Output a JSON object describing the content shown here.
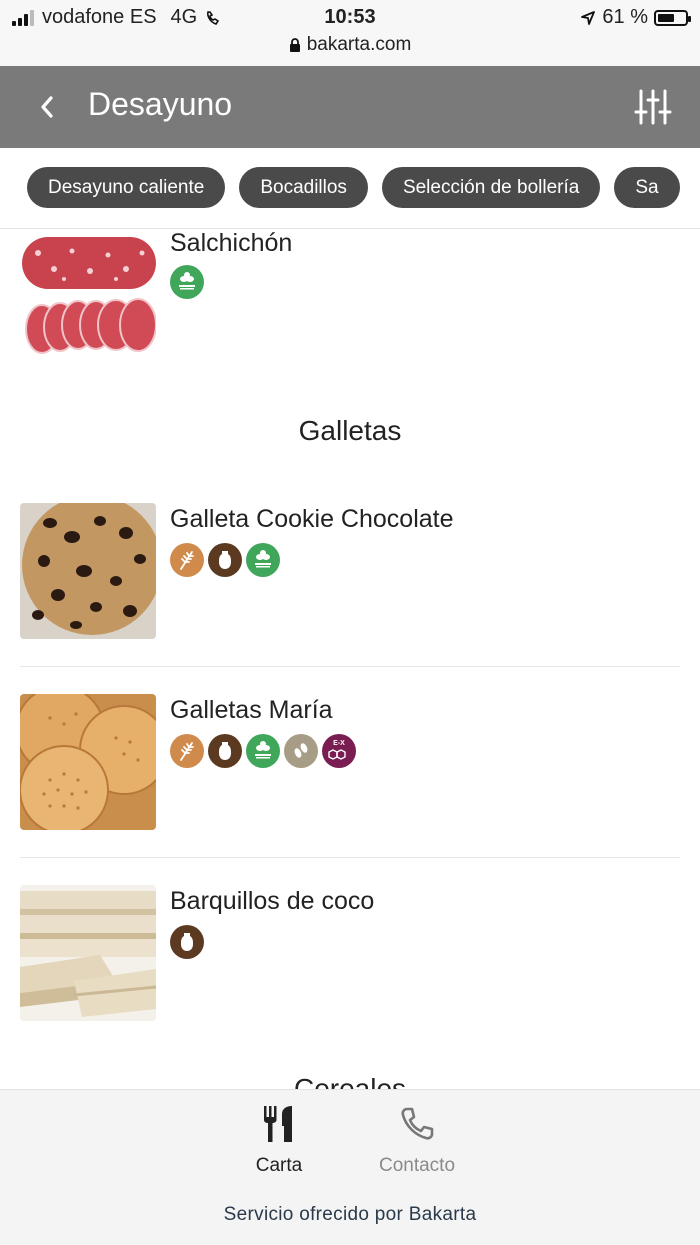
{
  "status_bar": {
    "carrier": "vodafone ES",
    "network": "4G",
    "time": "10:53",
    "battery": "61 %",
    "battery_level": 0.61,
    "url": "bakarta.com"
  },
  "header": {
    "title": "Desayuno"
  },
  "chips": [
    "Desayuno caliente",
    "Bocadillos",
    "Selección de bollería",
    "Sa"
  ],
  "items_top": [
    {
      "name": "Salchichón",
      "allergens": [
        "sulfites-icon"
      ]
    }
  ],
  "section_galletas": "Galletas",
  "galletas_items": [
    {
      "name": "Galleta Cookie Chocolate",
      "allergens": [
        "gluten-icon",
        "milk-icon",
        "sulfites-icon"
      ]
    },
    {
      "name": "Galletas María",
      "allergens": [
        "gluten-icon",
        "milk-icon",
        "sulfites-icon",
        "sesame-icon",
        "additives-icon"
      ]
    },
    {
      "name": "Barquillos de coco",
      "allergens": [
        "milk-icon"
      ]
    }
  ],
  "allergen_labels": {
    "additives_text": "E-X"
  },
  "section_next": "Cereales",
  "bottom_nav": {
    "carta": "Carta",
    "contacto": "Contacto"
  },
  "footer": "Servicio ofrecido por Bakarta",
  "colors": {
    "header_bg": "#7a7a7a",
    "chip_bg": "#4a4a4a",
    "gluten": "#d08a4c",
    "milk": "#5c3a22",
    "sulfites": "#3fa65a",
    "sesame": "#a79c85",
    "additives": "#7a1d52"
  }
}
